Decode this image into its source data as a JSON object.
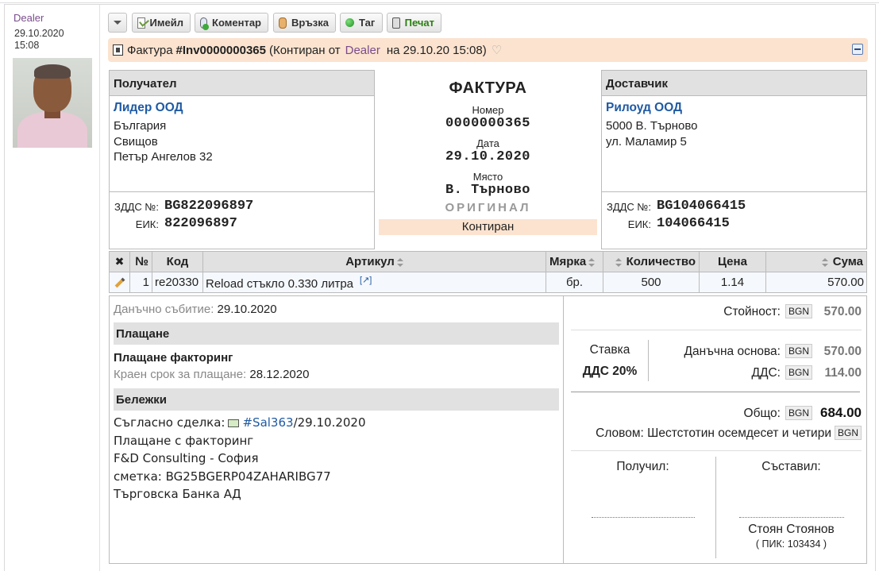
{
  "post": {
    "author": "Dealer",
    "date": "29.10.2020",
    "time": "15:08"
  },
  "toolbar": {
    "email": "Имейл",
    "comment": "Коментар",
    "link": "Връзка",
    "tag": "Таг",
    "print": "Печат"
  },
  "header": {
    "doc_type": "Фактура",
    "number": "#Inv0000000365",
    "status_prefix": "(Контиран от",
    "author": "Dealer",
    "status_suffix": "на 29.10.20 15:08)"
  },
  "recipient": {
    "heading": "Получател",
    "name": "Лидер ООД",
    "country": "България",
    "city": "Свищов",
    "street": "Петър Ангелов 32",
    "vat_label": "ЗДДС №:",
    "vat": "BG822096897",
    "eik_label": "ЕИК:",
    "eik": "822096897"
  },
  "invoice": {
    "title": "ФАКТУРА",
    "number_label": "Номер",
    "number": "0000000365",
    "date_label": "Дата",
    "date": "29.10.2020",
    "place_label": "Място",
    "place": "В. Търново",
    "original": "ОРИГИНАЛ",
    "status": "Контиран"
  },
  "supplier": {
    "heading": "Доставчик",
    "name": "Рилоуд ООД",
    "city": "5000 В. Търново",
    "street": "ул. Маламир 5",
    "vat_label": "ЗДДС №:",
    "vat": "BG104066415",
    "eik_label": "ЕИК:",
    "eik": "104066415"
  },
  "table": {
    "columns": [
      "№",
      "Код",
      "Артикул",
      "Мярка",
      "Количество",
      "Цена",
      "Сума"
    ],
    "rows": [
      {
        "no": "1",
        "code": "re20330",
        "article": "Reload стъкло 0.330 литра",
        "unit": "бр.",
        "qty": "500",
        "price": "1.14",
        "sum": "570.00"
      }
    ],
    "ext_link": "[↗]"
  },
  "details": {
    "tax_event_label": "Данъчно събитие:",
    "tax_event": "29.10.2020",
    "payment_heading": "Плащане",
    "payment_method": "Плащане факторинг",
    "due_label": "Краен срок за плащане:",
    "due": "28.12.2020",
    "notes_heading": "Бележки",
    "note1_prefix": "Съгласно сделка:",
    "note1_link": "#Sal363",
    "note1_suffix": "/29.10.2020",
    "note2": "Плащане с факторинг",
    "note3": "F&D Consulting - София",
    "note4": "сметка: BG25BGERP04ZAHARIBG77",
    "note5": "Търговска Банка АД"
  },
  "totals": {
    "currency": "BGN",
    "value_label": "Стойност:",
    "value": "570.00",
    "rate_label": "Ставка",
    "rate": "ДДС 20%",
    "base_label": "Данъчна основа:",
    "base": "570.00",
    "vat_label": "ДДС:",
    "vat": "114.00",
    "total_label": "Общо:",
    "total": "684.00",
    "words_label": "Словом:",
    "words": "Шестстотин осемдесет и четири",
    "received_label": "Получил:",
    "issued_label": "Съставил:",
    "issuer_name": "Стоян Стоянов",
    "issuer_pik": "( ПИК: 103434 )"
  }
}
